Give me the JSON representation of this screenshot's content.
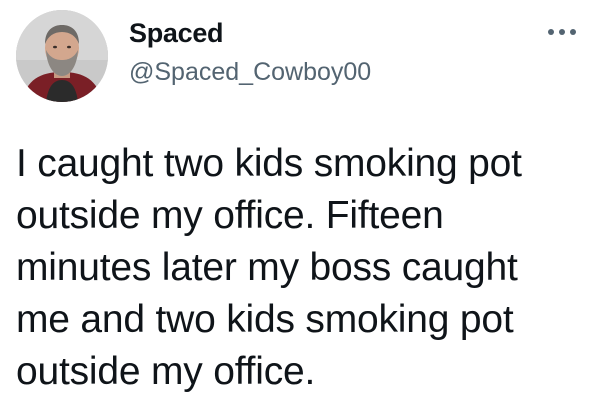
{
  "author": {
    "display_name": "Spaced",
    "handle": "@Spaced_Cowboy00",
    "avatar_icon": "profile-photo"
  },
  "menu": {
    "more_icon": "more-options-icon"
  },
  "tweet": {
    "text": "I caught two kids smoking pot\noutside my office. Fifteen\nminutes later my boss caught\nme and two kids smoking pot\noutside my office."
  },
  "colors": {
    "text_primary": "#0f1419",
    "text_secondary": "#536471",
    "background": "#ffffff"
  }
}
